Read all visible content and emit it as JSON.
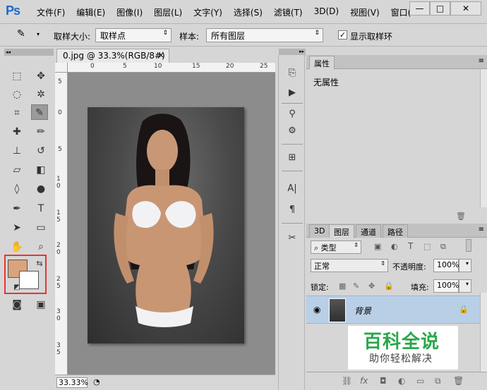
{
  "app": {
    "logo": "Ps"
  },
  "menu": [
    "文件(F)",
    "编辑(E)",
    "图像(I)",
    "图层(L)",
    "文字(Y)",
    "选择(S)",
    "滤镜(T)",
    "3D(D)",
    "视图(V)",
    "窗口(V"
  ],
  "window_controls": {
    "minimize": "—",
    "maximize": "□",
    "close": "✕"
  },
  "options": {
    "sample_size_label": "取样大小:",
    "sample_size_value": "取样点",
    "sample_label": "样本:",
    "sample_value": "所有图层",
    "show_ring_label": "显示取样环",
    "show_ring_checked": true
  },
  "colors": {
    "foreground": "#d9a47c",
    "background": "#ffffff",
    "highlight": "#e53535"
  },
  "document": {
    "tab_title": "0.jpg @ 33.3%(RGB/8#)",
    "close_label": "×",
    "ruler_top": [
      "0",
      "5",
      "10",
      "15",
      "20",
      "25"
    ],
    "ruler_left": [
      "5",
      "0",
      "5",
      "1 0",
      "1 5",
      "2 0",
      "2 5",
      "3 0",
      "3 5"
    ],
    "zoom": "33.33%"
  },
  "properties_panel": {
    "tab_properties": "属性",
    "content": "无属性"
  },
  "layers_panel": {
    "tabs": [
      "3D",
      "图层",
      "通道",
      "路径"
    ],
    "filter_label": "类型",
    "blend_mode": "正常",
    "opacity_label": "不透明度:",
    "opacity_value": "100%",
    "lock_label": "锁定:",
    "fill_label": "填充:",
    "fill_value": "100%",
    "layer_name": "背景"
  },
  "watermark": {
    "title": "百科全说",
    "subtitle": "助你轻松解决"
  }
}
